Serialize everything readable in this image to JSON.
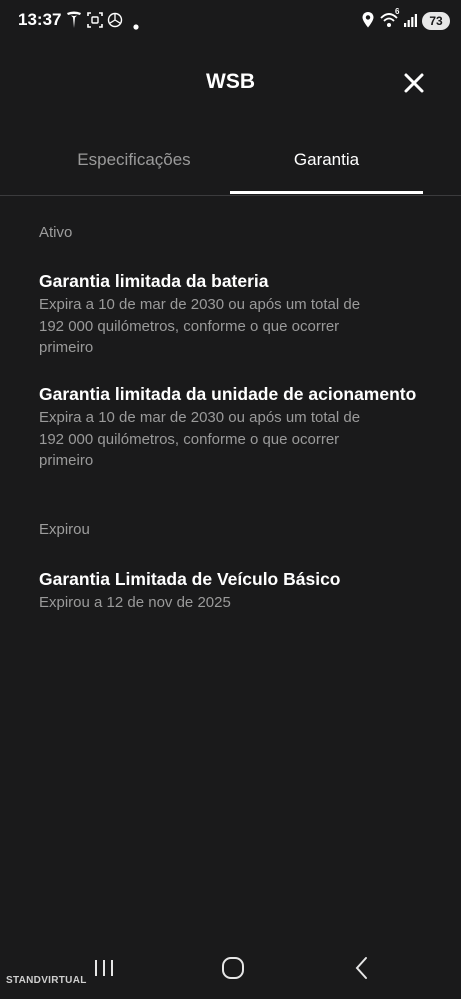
{
  "status_bar": {
    "time": "13:37",
    "battery": "73",
    "network_badge": "6"
  },
  "header": {
    "title": "WSB"
  },
  "tabs": [
    {
      "label": "Especificações",
      "active": false
    },
    {
      "label": "Garantia",
      "active": true
    }
  ],
  "sections": {
    "active": {
      "label": "Ativo",
      "items": [
        {
          "title": "Garantia limitada da bateria",
          "desc_lines": [
            "Expira a 10 de mar de 2030 ou após um total de",
            "192 000 quilómetros, conforme o que ocorrer",
            "primeiro"
          ]
        },
        {
          "title": "Garantia limitada da unidade de acionamento",
          "desc_lines": [
            "Expira a 10 de mar de 2030 ou após um total de",
            "192 000 quilómetros, conforme o que ocorrer",
            "primeiro"
          ]
        }
      ]
    },
    "expired": {
      "label": "Expirou",
      "items": [
        {
          "title": "Garantia Limitada de Veículo Básico",
          "desc_lines": [
            "Expirou a 12 de nov de 2025"
          ]
        }
      ]
    }
  },
  "watermark": "STANDVIRTUAL",
  "colors": {
    "background": "#1a1a1b",
    "text_primary": "#ffffff",
    "text_secondary": "#9a9a9a",
    "divider": "#3b3b3d"
  }
}
